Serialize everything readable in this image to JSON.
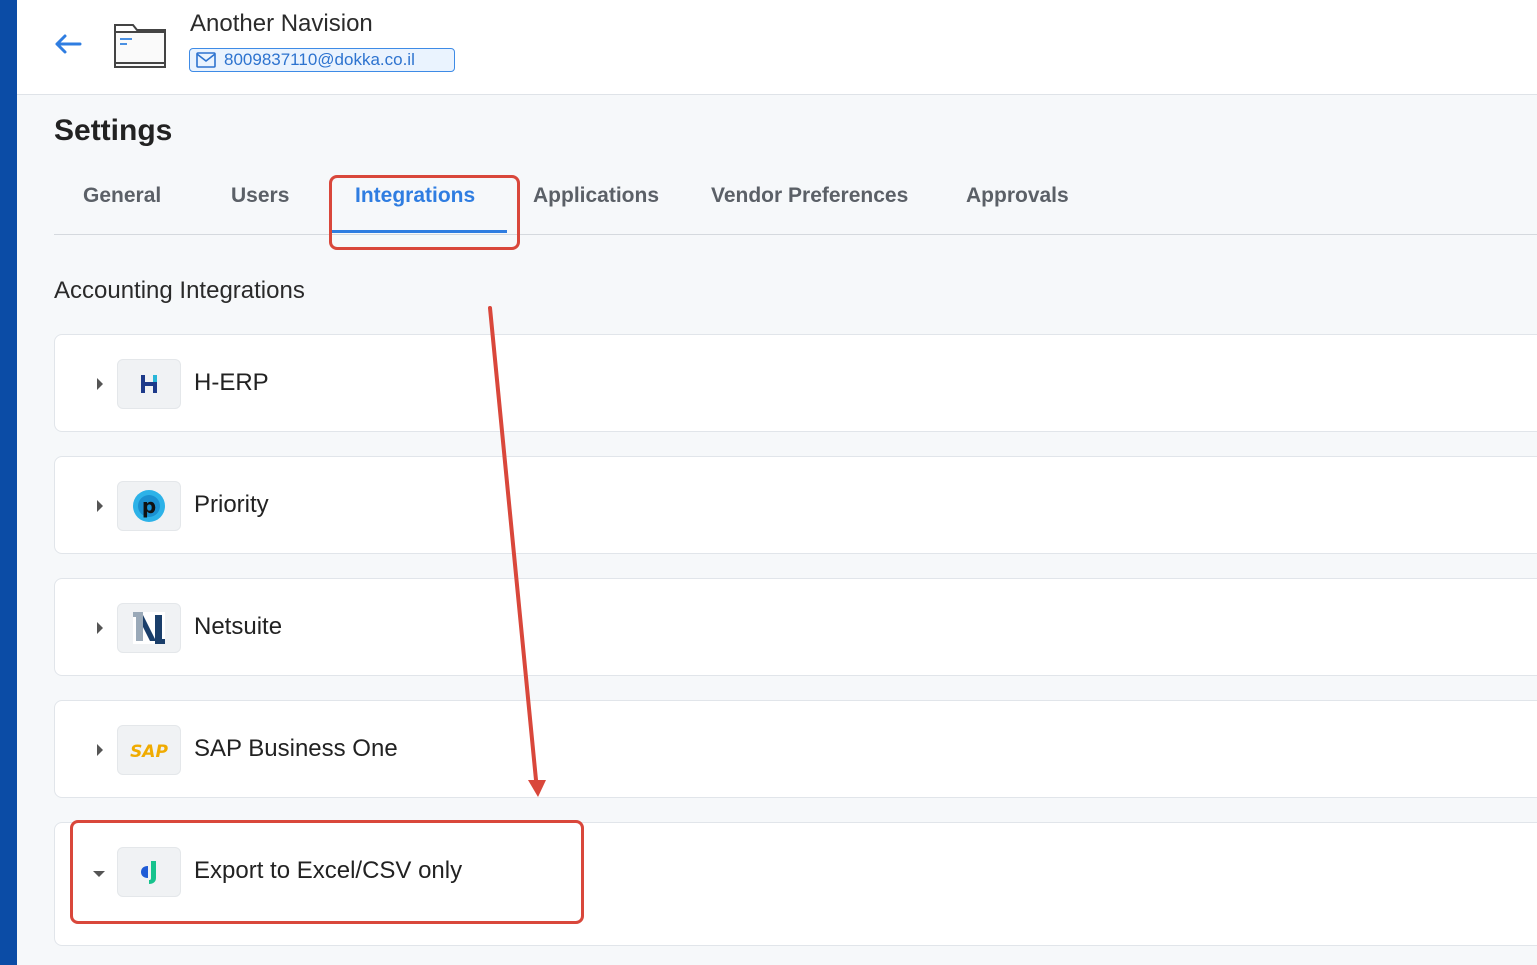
{
  "header": {
    "company_name": "Another Navision",
    "email": "8009837110@dokka.co.il"
  },
  "page": {
    "title": "Settings"
  },
  "tabs": [
    {
      "label": "General",
      "active": false
    },
    {
      "label": "Users",
      "active": false
    },
    {
      "label": "Integrations",
      "active": true
    },
    {
      "label": "Applications",
      "active": false
    },
    {
      "label": "Vendor Preferences",
      "active": false
    },
    {
      "label": "Approvals",
      "active": false
    }
  ],
  "accounting": {
    "section_title": "Accounting Integrations",
    "items": [
      {
        "label": "H-ERP",
        "icon": "h-erp-logo-icon",
        "expanded": false
      },
      {
        "label": "Priority",
        "icon": "priority-logo-icon",
        "expanded": false
      },
      {
        "label": "Netsuite",
        "icon": "netsuite-logo-icon",
        "expanded": false
      },
      {
        "label": "SAP Business One",
        "icon": "sap-logo-icon",
        "expanded": false
      },
      {
        "label": "Export to Excel/CSV only",
        "icon": "dokka-logo-icon",
        "expanded": true
      }
    ]
  },
  "colors": {
    "accent": "#2f7de1",
    "sidebar": "#0b4ca6",
    "annotation": "#d9473b"
  }
}
